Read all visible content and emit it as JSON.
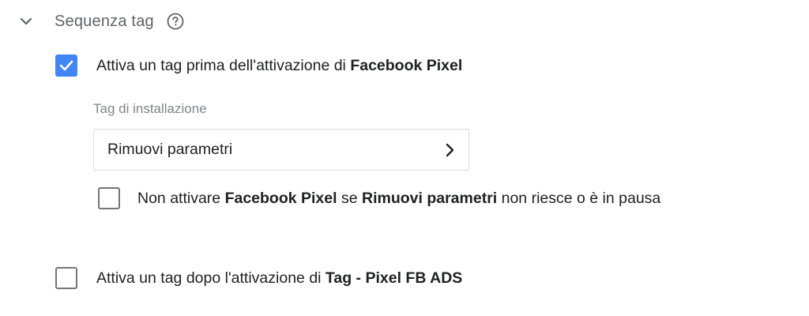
{
  "section": {
    "title": "Sequenza tag",
    "expanded": true,
    "chevron_icon": "chevron-down-icon",
    "help_icon": "help-circle-icon"
  },
  "setup": {
    "checked": true,
    "text_prefix": "Attiva un tag prima dell'attivazione di ",
    "text_bold": "Facebook Pixel",
    "field_label": "Tag di installazione",
    "selected_tag": "Rimuovi parametri",
    "select_icon": "chevron-right-icon",
    "dont_fire": {
      "checked": false,
      "part1": "Non attivare ",
      "bold1": "Facebook Pixel",
      "part2": " se ",
      "bold2": "Rimuovi parametri",
      "part3": " non riesce o è in pausa"
    }
  },
  "cleanup": {
    "checked": false,
    "text_prefix": "Attiva un tag dopo l'attivazione di ",
    "text_bold": "Tag - Pixel FB ADS"
  },
  "colors": {
    "accent": "#4285f4",
    "text": "#202124",
    "muted": "#5f6368",
    "border": "#dadce0",
    "checkbox_border": "#757575"
  }
}
